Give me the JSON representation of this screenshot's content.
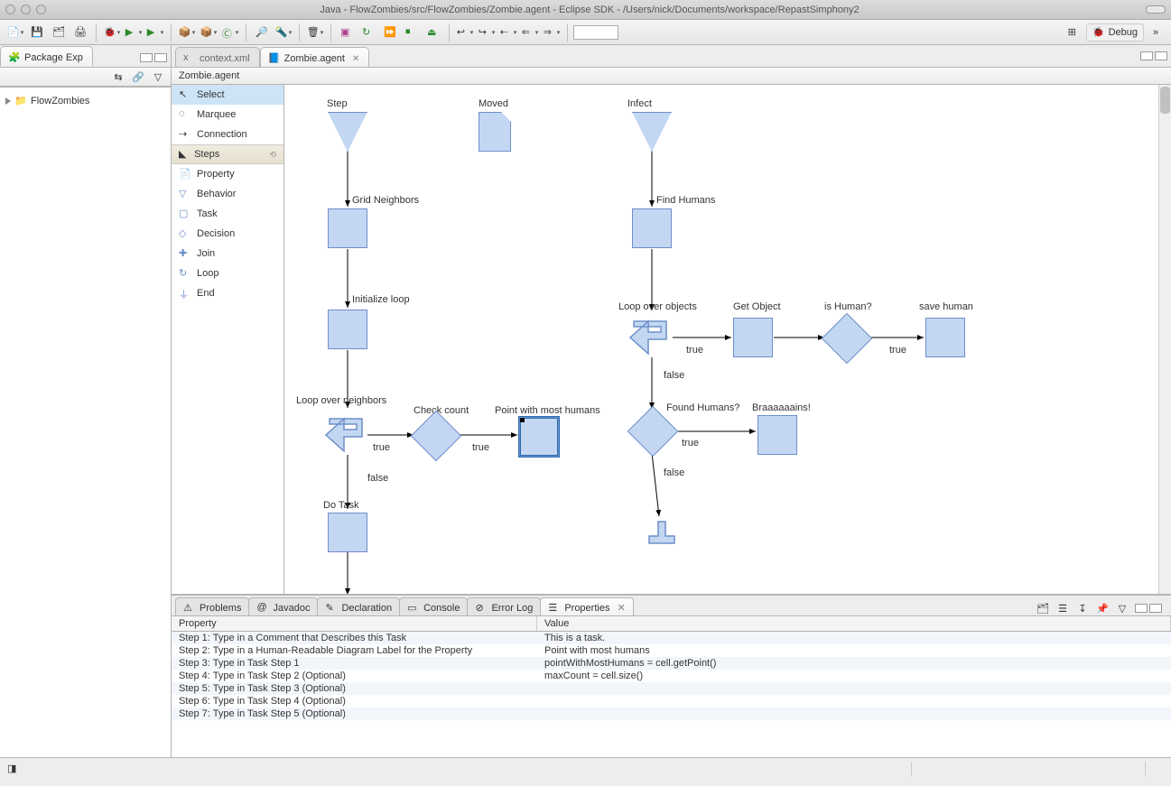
{
  "window": {
    "title": "Java - FlowZombies/src/FlowZombies/Zombie.agent - Eclipse SDK - /Users/nick/Documents/workspace/RepastSimphony2"
  },
  "perspective": {
    "label": "Debug"
  },
  "package_explorer": {
    "title": "Package Exp",
    "project": "FlowZombies"
  },
  "editor": {
    "tabs": [
      {
        "label": "context.xml",
        "active": false
      },
      {
        "label": "Zombie.agent",
        "active": true
      }
    ],
    "breadcrumb": "Zombie.agent"
  },
  "palette": {
    "tools": [
      {
        "label": "Select",
        "selected": true
      },
      {
        "label": "Marquee"
      },
      {
        "label": "Connection"
      }
    ],
    "group": "Steps",
    "steps": [
      {
        "label": "Property"
      },
      {
        "label": "Behavior"
      },
      {
        "label": "Task"
      },
      {
        "label": "Decision"
      },
      {
        "label": "Join"
      },
      {
        "label": "Loop"
      },
      {
        "label": "End"
      }
    ]
  },
  "diagram": {
    "nodes": {
      "step": "Step",
      "moved": "Moved",
      "infect": "Infect",
      "grid_neighbors": "Grid Neighbors",
      "find_humans": "Find Humans",
      "init_loop": "Initialize loop",
      "loop_objects": "Loop over objects",
      "get_object": "Get Object",
      "is_human": "is Human?",
      "save_human": "save human",
      "loop_neighbors": "Loop over neighbors",
      "check_count": "Check count",
      "point_most": "Point with most humans",
      "found_humans": "Found Humans?",
      "braains": "Braaaaaains!",
      "do_task": "Do Task"
    },
    "edges": {
      "true": "true",
      "false": "false"
    }
  },
  "bottom_tabs": [
    {
      "label": "Problems"
    },
    {
      "label": "Javadoc"
    },
    {
      "label": "Declaration"
    },
    {
      "label": "Console"
    },
    {
      "label": "Error Log"
    },
    {
      "label": "Properties",
      "active": true
    }
  ],
  "properties": {
    "col_property": "Property",
    "col_value": "Value",
    "rows": [
      {
        "p": "Step 1: Type in a Comment that Describes this Task",
        "v": "This is a task."
      },
      {
        "p": "Step 2: Type in a Human-Readable Diagram Label for the Property",
        "v": "Point with most humans"
      },
      {
        "p": "Step 3: Type in Task Step 1",
        "v": "pointWithMostHumans = cell.getPoint()"
      },
      {
        "p": "Step 4: Type in Task Step 2 (Optional)",
        "v": "maxCount = cell.size()"
      },
      {
        "p": "Step 5: Type in Task Step 3 (Optional)",
        "v": ""
      },
      {
        "p": "Step 6: Type in Task Step 4 (Optional)",
        "v": ""
      },
      {
        "p": "Step 7: Type in Task Step 5 (Optional)",
        "v": ""
      }
    ]
  }
}
